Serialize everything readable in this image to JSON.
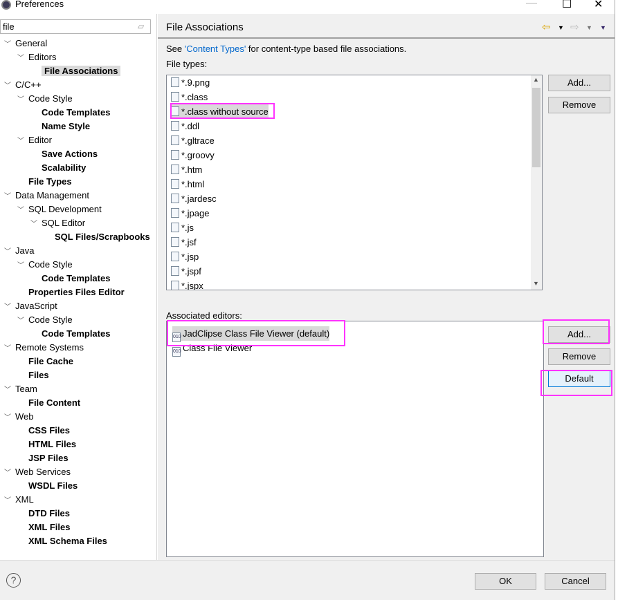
{
  "window": {
    "title": "Preferences",
    "minimize": "—",
    "maximize": "☐",
    "close": "✕"
  },
  "search": {
    "value": "file",
    "clear_icon": "eraser-icon"
  },
  "tree": [
    {
      "label": "General",
      "level": 0,
      "expanded": true,
      "bold": false
    },
    {
      "label": "Editors",
      "level": 1,
      "expanded": true,
      "bold": false
    },
    {
      "label": "File Associations",
      "level": 2,
      "bold": true,
      "selected": true
    },
    {
      "label": "C/C++",
      "level": 0,
      "expanded": true,
      "bold": false
    },
    {
      "label": "Code Style",
      "level": 1,
      "expanded": true,
      "bold": false
    },
    {
      "label": "Code Templates",
      "level": 2,
      "bold": true
    },
    {
      "label": "Name Style",
      "level": 2,
      "bold": true
    },
    {
      "label": "Editor",
      "level": 1,
      "expanded": true,
      "bold": false
    },
    {
      "label": "Save Actions",
      "level": 2,
      "bold": true
    },
    {
      "label": "Scalability",
      "level": 2,
      "bold": true
    },
    {
      "label": "File Types",
      "level": 1,
      "bold": true
    },
    {
      "label": "Data Management",
      "level": 0,
      "expanded": true,
      "bold": false
    },
    {
      "label": "SQL Development",
      "level": 1,
      "expanded": true,
      "bold": false
    },
    {
      "label": "SQL Editor",
      "level": 2,
      "expanded": true,
      "bold": false
    },
    {
      "label": "SQL Files/Scrapbooks",
      "level": 3,
      "bold": true
    },
    {
      "label": "Java",
      "level": 0,
      "expanded": true,
      "bold": false
    },
    {
      "label": "Code Style",
      "level": 1,
      "expanded": true,
      "bold": false
    },
    {
      "label": "Code Templates",
      "level": 2,
      "bold": true
    },
    {
      "label": "Properties Files Editor",
      "level": 1,
      "bold": true
    },
    {
      "label": "JavaScript",
      "level": 0,
      "expanded": true,
      "bold": false
    },
    {
      "label": "Code Style",
      "level": 1,
      "expanded": true,
      "bold": false
    },
    {
      "label": "Code Templates",
      "level": 2,
      "bold": true
    },
    {
      "label": "Remote Systems",
      "level": 0,
      "expanded": true,
      "bold": false
    },
    {
      "label": "File Cache",
      "level": 1,
      "bold": true
    },
    {
      "label": "Files",
      "level": 1,
      "bold": true
    },
    {
      "label": "Team",
      "level": 0,
      "expanded": true,
      "bold": false
    },
    {
      "label": "File Content",
      "level": 1,
      "bold": true
    },
    {
      "label": "Web",
      "level": 0,
      "expanded": true,
      "bold": false
    },
    {
      "label": "CSS Files",
      "level": 1,
      "bold": true
    },
    {
      "label": "HTML Files",
      "level": 1,
      "bold": true
    },
    {
      "label": "JSP Files",
      "level": 1,
      "bold": true
    },
    {
      "label": "Web Services",
      "level": 0,
      "expanded": true,
      "bold": false
    },
    {
      "label": "WSDL Files",
      "level": 1,
      "bold": true
    },
    {
      "label": "XML",
      "level": 0,
      "expanded": true,
      "bold": false
    },
    {
      "label": "DTD Files",
      "level": 1,
      "bold": true
    },
    {
      "label": "XML Files",
      "level": 1,
      "bold": true
    },
    {
      "label": "XML Schema Files",
      "level": 1,
      "bold": true
    }
  ],
  "page": {
    "title": "File Associations",
    "desc_prefix": "See ",
    "desc_link": "'Content Types'",
    "desc_suffix": " for content-type based file associations.",
    "file_types_label": "File types:",
    "file_types": [
      "*.9.png",
      "*.class",
      "*.class without source",
      "*.ddl",
      "*.gltrace",
      "*.groovy",
      "*.htm",
      "*.html",
      "*.jardesc",
      "*.jpage",
      "*.js",
      "*.jsf",
      "*.jsp",
      "*.jspf",
      "*.jspx"
    ],
    "selected_file_type": "*.class without source",
    "file_types_add": "Add...",
    "file_types_remove": "Remove",
    "editors_label": "Associated editors:",
    "editors": [
      "JadClipse Class File Viewer (default)",
      "Class File Viewer"
    ],
    "editors_add": "Add...",
    "editors_remove": "Remove",
    "editors_default": "Default"
  },
  "footer": {
    "help": "?",
    "ok": "OK",
    "cancel": "Cancel"
  },
  "highlight_color": "#ff33ff"
}
